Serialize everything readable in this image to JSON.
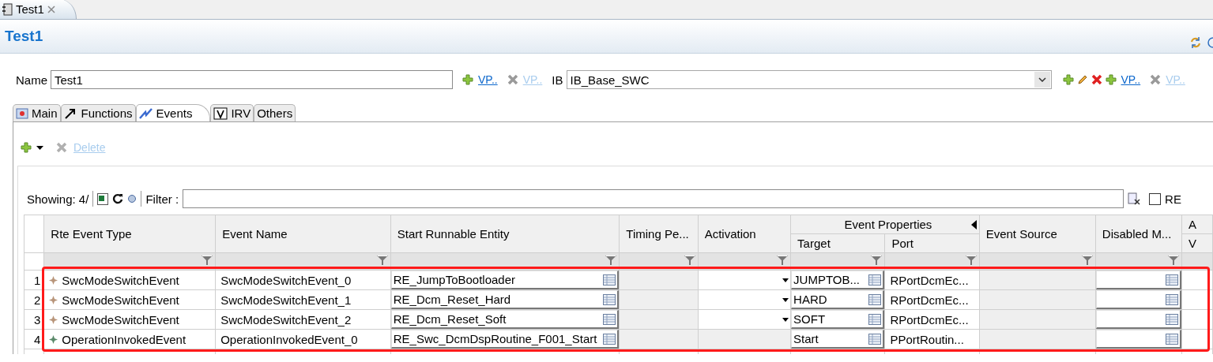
{
  "editor_tab": {
    "title": "Test1"
  },
  "header": {
    "title": "Test1"
  },
  "form": {
    "name_label": "Name",
    "name_value": "Test1",
    "name_actions": [
      {
        "kind": "add",
        "label": "VP..",
        "disabled": false
      },
      {
        "kind": "remove",
        "label": "VP..",
        "disabled": true
      }
    ],
    "ib_label": "IB",
    "ib_value": "IB_Base_SWC",
    "ib_actions": [
      {
        "kind": "add"
      },
      {
        "kind": "edit"
      },
      {
        "kind": "delete"
      },
      {
        "kind": "add",
        "label": "VP..",
        "disabled": false
      },
      {
        "kind": "remove",
        "label": "VP..",
        "disabled": true
      }
    ]
  },
  "tabs": [
    {
      "label": "Main",
      "kind": "main",
      "selected": false
    },
    {
      "label": "Functions",
      "kind": "functions",
      "selected": false
    },
    {
      "label": "Events",
      "kind": "events",
      "selected": true
    },
    {
      "label": "IRV",
      "kind": "irv",
      "selected": false
    },
    {
      "label": "Others",
      "kind": "plain",
      "selected": false
    }
  ],
  "toolbar": {
    "delete": {
      "label": "Delete",
      "disabled": true
    }
  },
  "filter_bar": {
    "showing": "Showing: 4/",
    "filter_label": "Filter :",
    "re_checkbox": {
      "label": "RE",
      "checked": false
    }
  },
  "table": {
    "columns": [
      {
        "label": "Rte Event Type"
      },
      {
        "label": "Event Name"
      },
      {
        "label": "Start Runnable Entity"
      },
      {
        "label": "Timing Pe..."
      },
      {
        "label": "Activation"
      },
      {
        "label": "Event Properties",
        "colspan": 2,
        "children": [
          {
            "label": "Target"
          },
          {
            "label": "Port"
          }
        ]
      },
      {
        "label": "Event Source"
      },
      {
        "label": "Disabled M..."
      },
      {
        "label": "A",
        "children": [
          {
            "label": "V"
          }
        ]
      }
    ],
    "rows": [
      {
        "number": "1",
        "cells": [
          {
            "kind": "event-type",
            "text": "SwcModeSwitchEvent",
            "color": "#b8957a"
          },
          {
            "kind": "text",
            "text": "SwcModeSwitchEvent_0"
          },
          {
            "kind": "reference",
            "text": "RE_JumpToBootloader"
          },
          {
            "kind": "blank"
          },
          {
            "kind": "combo"
          },
          {
            "kind": "reference",
            "text": "JUMPTOB..."
          },
          {
            "kind": "text",
            "text": "RPortDcmEc..."
          },
          {
            "kind": "blank"
          },
          {
            "kind": "reference"
          },
          {
            "kind": "empty"
          }
        ]
      },
      {
        "number": "2",
        "cells": [
          {
            "kind": "event-type",
            "text": "SwcModeSwitchEvent",
            "color": "#b8957a"
          },
          {
            "kind": "text",
            "text": "SwcModeSwitchEvent_1"
          },
          {
            "kind": "reference",
            "text": "RE_Dcm_Reset_Hard"
          },
          {
            "kind": "blank"
          },
          {
            "kind": "combo"
          },
          {
            "kind": "reference",
            "text": "HARD"
          },
          {
            "kind": "text",
            "text": "RPortDcmEc..."
          },
          {
            "kind": "blank"
          },
          {
            "kind": "reference"
          },
          {
            "kind": "empty"
          }
        ]
      },
      {
        "number": "3",
        "cells": [
          {
            "kind": "event-type",
            "text": "SwcModeSwitchEvent",
            "color": "#b8957a"
          },
          {
            "kind": "text",
            "text": "SwcModeSwitchEvent_2"
          },
          {
            "kind": "reference",
            "text": "RE_Dcm_Reset_Soft"
          },
          {
            "kind": "blank"
          },
          {
            "kind": "combo"
          },
          {
            "kind": "reference",
            "text": "SOFT"
          },
          {
            "kind": "text",
            "text": "RPortDcmEc..."
          },
          {
            "kind": "blank"
          },
          {
            "kind": "reference"
          },
          {
            "kind": "empty"
          }
        ]
      },
      {
        "number": "4",
        "cells": [
          {
            "kind": "event-type",
            "text": "OperationInvokedEvent",
            "color": "#5a8a6a"
          },
          {
            "kind": "text",
            "text": "OperationInvokedEvent_0"
          },
          {
            "kind": "reference",
            "text": "RE_Swc_DcmDspRoutine_F001_Start"
          },
          {
            "kind": "blank"
          },
          {
            "kind": "blank"
          },
          {
            "kind": "reference",
            "text": "Start"
          },
          {
            "kind": "text",
            "text": "PPortRoutin..."
          },
          {
            "kind": "blank"
          },
          {
            "kind": "reference"
          },
          {
            "kind": "empty"
          }
        ]
      }
    ]
  }
}
